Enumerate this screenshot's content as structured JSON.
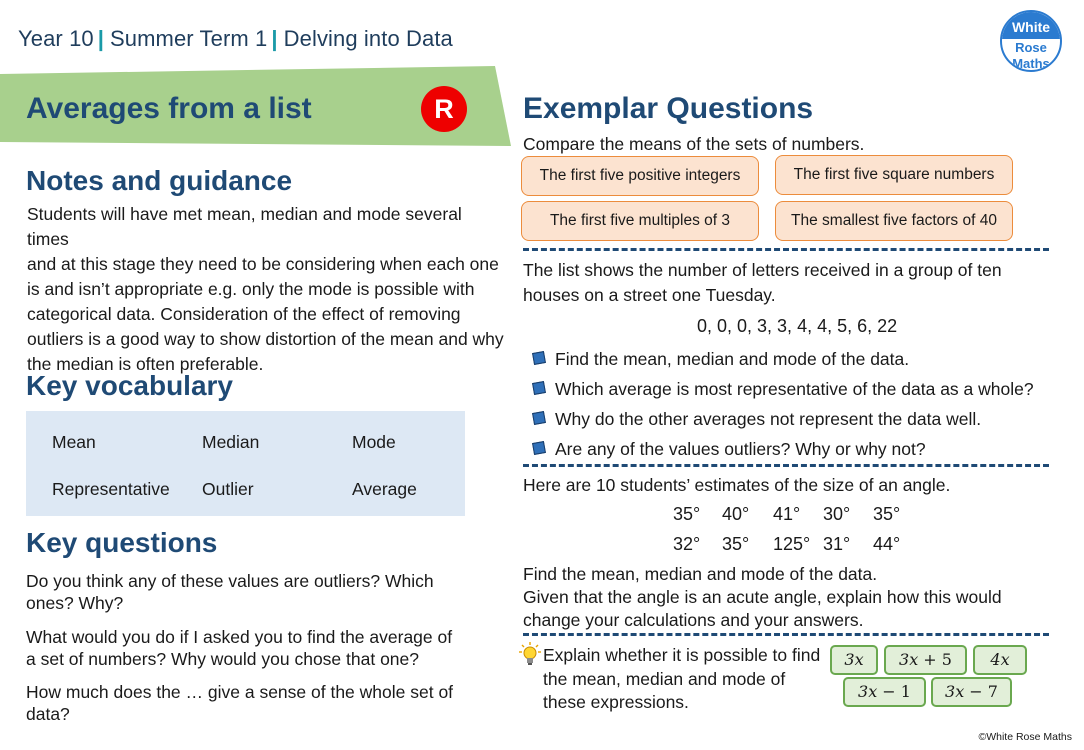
{
  "header": {
    "breadcrumb": [
      "Year 10",
      "Summer Term  1",
      "Delving into Data"
    ],
    "logo": {
      "line1": "White",
      "line2": "Rose",
      "line3": "Maths",
      "icon": "white-rose-maths-logo"
    }
  },
  "banner": {
    "title": "Averages from a list",
    "badge": "R",
    "colors": {
      "banner": "#a8d08d",
      "badge": "#ee0000",
      "title": "#1f4a75"
    }
  },
  "notes": {
    "heading": "Notes and guidance",
    "lines": [
      "Students will have met mean, median and mode several times",
      "and at this stage they need to be considering when each one",
      "is and isn’t appropriate e.g. only the mode is possible with",
      "categorical data. Consideration of the effect of removing",
      "outliers is a good way to show distortion of the mean and why",
      "the median is often preferable."
    ]
  },
  "vocabulary": {
    "heading": "Key vocabulary",
    "words": [
      "Mean",
      "Median",
      "Mode",
      "Representative",
      "Outlier",
      "Average"
    ]
  },
  "key_questions": {
    "heading": "Key questions",
    "items": [
      "Do you think any of these values are outliers? Which ones? Why?",
      "What would you do if I asked you to find the average of a set of numbers? Why would you chose that one?",
      "How much does the … give a sense of the whole set of data?"
    ]
  },
  "exemplar": {
    "heading": "Exemplar Questions",
    "q1": {
      "prompt": "Compare the means of the sets of numbers.",
      "cards": [
        "The first five positive integers",
        "The first five square numbers",
        "The first five multiples of 3",
        "The smallest five factors of 40"
      ]
    },
    "q2": {
      "lines": [
        "The list shows the number of letters received in a group of ten",
        "houses on a street one Tuesday."
      ],
      "data": "0, 0, 0, 3, 3, 4, 4, 5, 6, 22",
      "bullets": [
        "Find the mean, median and mode of the data.",
        "Which average is most representative of the data as a whole?",
        "Why do the other averages not represent the data well.",
        "Are any of the values outliers?  Why or why not?"
      ]
    },
    "q3": {
      "intro": "Here are 10 students’ estimates of the size of an angle.",
      "angles_row1": [
        "35°",
        "40°",
        "41°",
        "30°",
        "35°"
      ],
      "angles_row2": [
        "32°",
        "35°",
        "125°",
        "31°",
        "44°"
      ],
      "lines": [
        "Find the mean, median and mode of the data.",
        "Given that the angle is an acute angle, explain how this would",
        "change your calculations and your answers."
      ]
    },
    "q4": {
      "lines": [
        "Explain whether it is possible to find",
        "the mean, median and mode of",
        "these expressions."
      ],
      "expressions": [
        {
          "var": "3x",
          "rest": ""
        },
        {
          "var": "3x",
          "rest": " + 5"
        },
        {
          "var": "4x",
          "rest": ""
        },
        {
          "var": "3x",
          "rest": " − 1"
        },
        {
          "var": "3x",
          "rest": " − 7"
        }
      ]
    }
  },
  "footer": {
    "copyright": "©White Rose Maths"
  }
}
